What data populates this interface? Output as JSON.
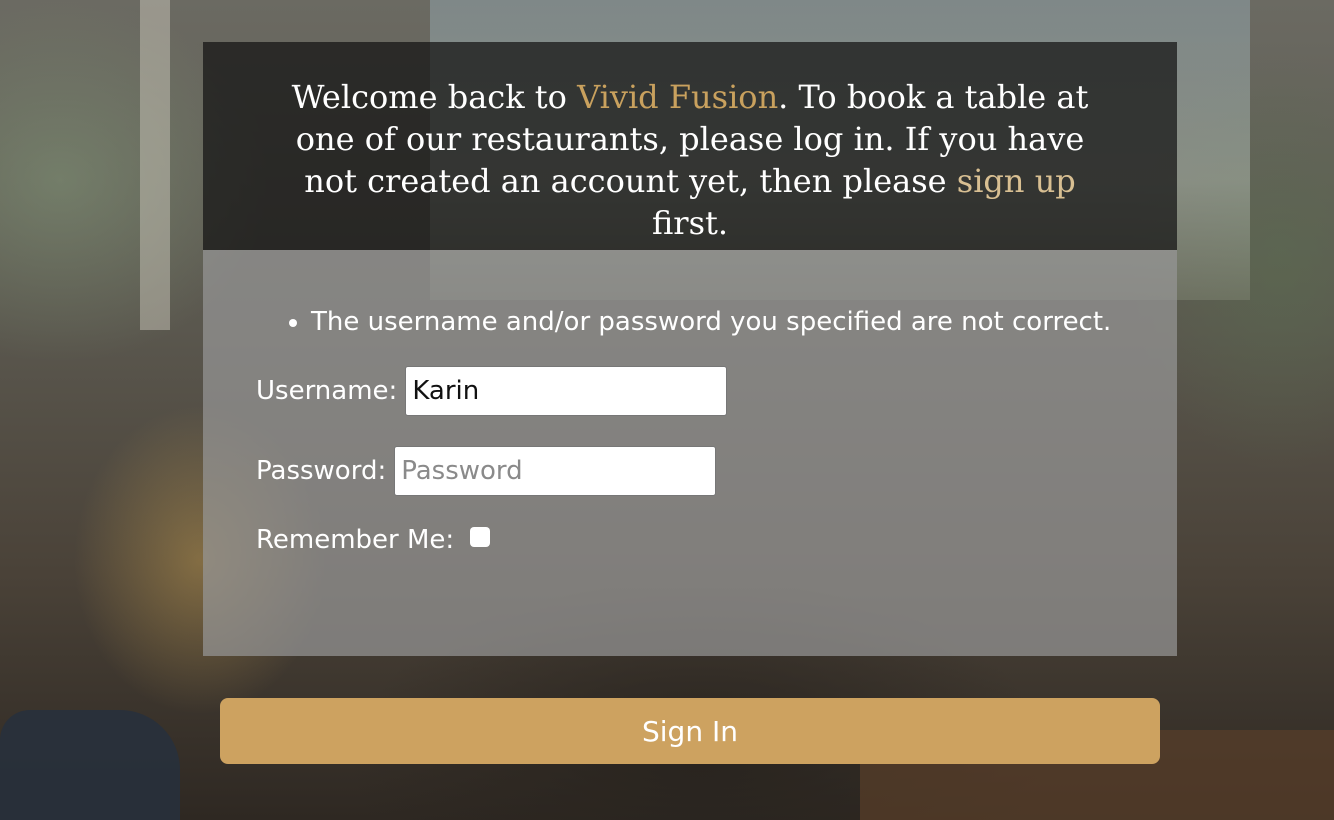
{
  "header": {
    "text_1": "Welcome back to ",
    "brand": "Vivid Fusion",
    "text_2": ". To book a table at one of our restaurants, please log in. If you have not created an account yet, then please ",
    "signup_link": "sign up",
    "text_3": " first."
  },
  "form": {
    "errors": [
      "The username and/or password you specified are not correct."
    ],
    "username": {
      "label": "Username:",
      "value": "Karin"
    },
    "password": {
      "label": "Password:",
      "placeholder": "Password",
      "value": ""
    },
    "remember": {
      "label": "Remember Me:",
      "checked": false
    },
    "submit_label": "Sign In"
  },
  "colors": {
    "accent": "#c9a15e",
    "link": "#d8bf92",
    "button": "#cda260"
  }
}
